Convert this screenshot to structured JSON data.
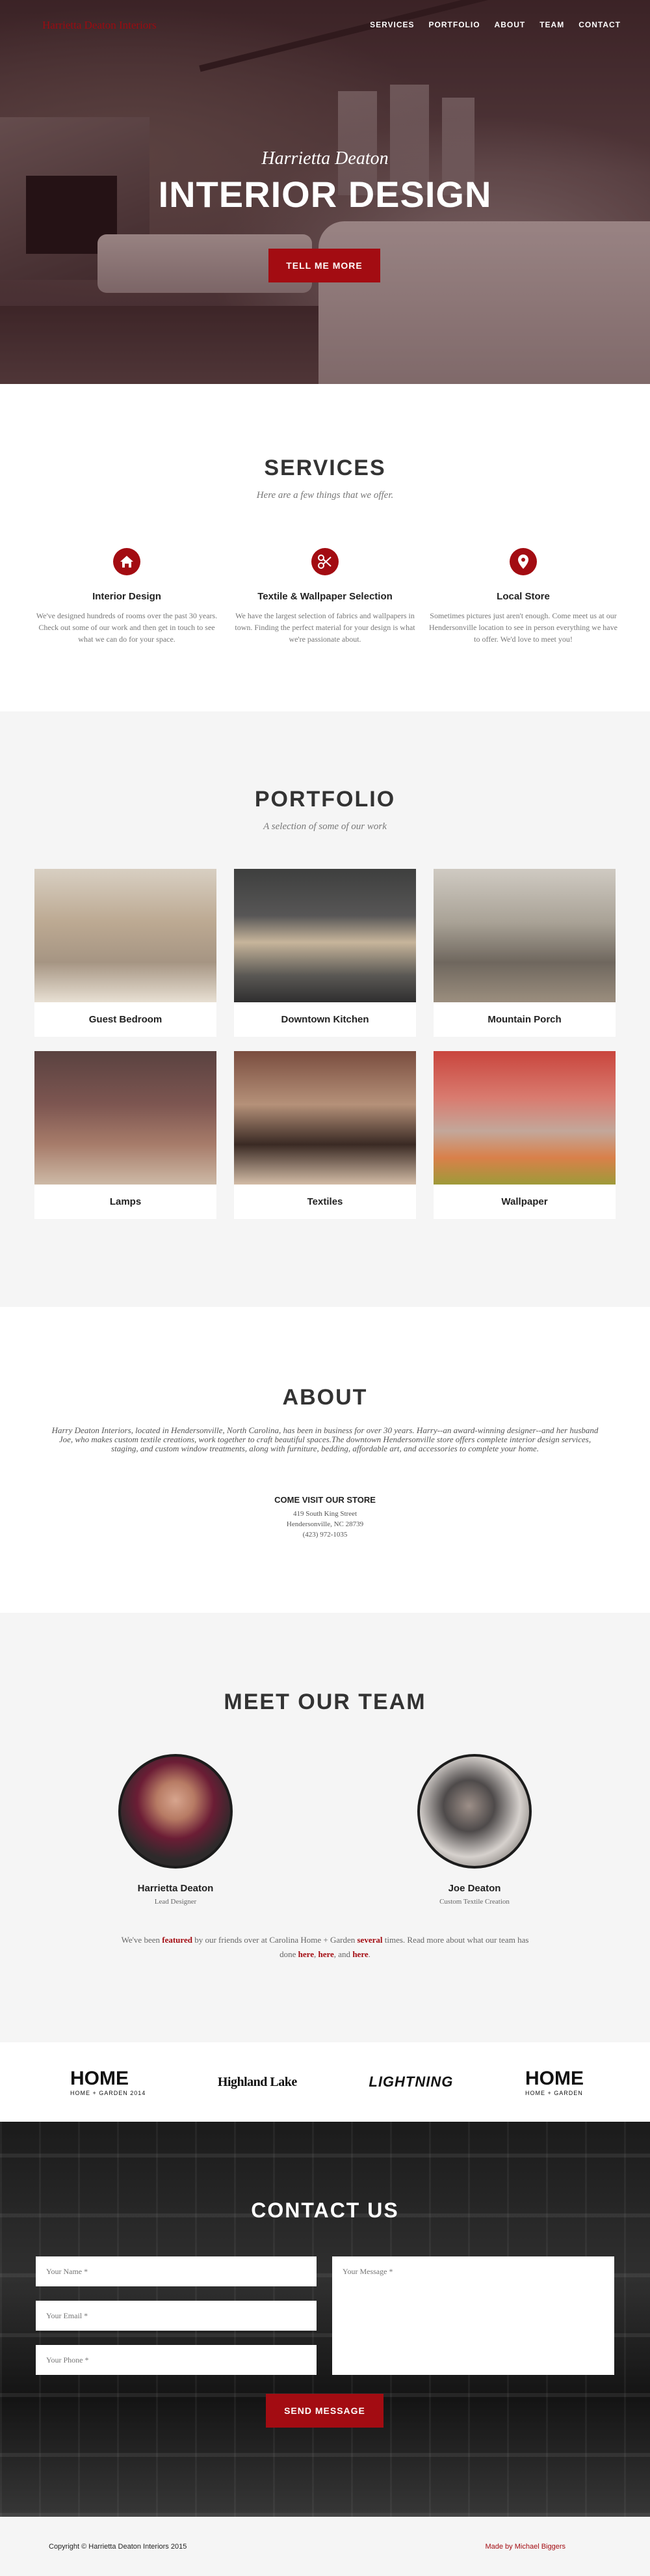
{
  "nav": {
    "brand": "Harrietta Deaton Interiors",
    "items": [
      "SERVICES",
      "PORTFOLIO",
      "ABOUT",
      "TEAM",
      "CONTACT"
    ]
  },
  "hero": {
    "subtitle": "Harrietta Deaton",
    "title": "INTERIOR DESIGN",
    "button": "TELL ME MORE"
  },
  "services": {
    "title": "SERVICES",
    "subtitle": "Here are a few things that we offer.",
    "items": [
      {
        "icon": "home-icon",
        "title": "Interior Design",
        "text": "We've designed hundreds of rooms over the past 30 years. Check out some of our work and then get in touch to see what we can do for your space."
      },
      {
        "icon": "scissors-icon",
        "title": "Textile & Wallpaper Selection",
        "text": "We have the largest selection of fabrics and wallpapers in town. Finding the perfect material for your design is what we're passionate about."
      },
      {
        "icon": "map-marker-icon",
        "title": "Local Store",
        "text": "Sometimes pictures just aren't enough. Come meet us at our Hendersonville location to see in person everything we have to offer. We'd love to meet you!"
      }
    ]
  },
  "portfolio": {
    "title": "PORTFOLIO",
    "subtitle": "A selection of some of our work",
    "items": [
      "Guest Bedroom",
      "Downtown Kitchen",
      "Mountain Porch",
      "Lamps",
      "Textiles",
      "Wallpaper"
    ]
  },
  "about": {
    "title": "ABOUT",
    "text": "Harry Deaton Interiors, located in Hendersonville, North Carolina, has been in business for over 30 years. Harry--an award-winning designer--and her husband Joe, who makes custom textile creations, work together to craft beautiful spaces.The downtown Hendersonville store offers complete interior design services, staging, and custom window treatments, along with furniture, bedding, affordable art, and accessories to complete your home.",
    "visit_title": "COME VISIT OUR STORE",
    "address_line1": "419 South King Street",
    "address_line2": "Hendersonville, NC 28739",
    "phone": "(423) 972-1035"
  },
  "team": {
    "title": "MEET OUR TEAM",
    "members": [
      {
        "name": "Harrietta Deaton",
        "role": "Lead Designer"
      },
      {
        "name": "Joe Deaton",
        "role": "Custom Textile Creation"
      }
    ],
    "note_1": "We've been ",
    "note_link_featured": "featured",
    "note_2": " by our friends over at Carolina Home + Garden ",
    "note_link_several": "several",
    "note_3": " times. Read more about what our team has done ",
    "note_link_here1": "here",
    "note_4": ", ",
    "note_link_here2": "here",
    "note_5": ", and ",
    "note_link_here3": "here",
    "note_6": "."
  },
  "logos": {
    "logo1": "HOME",
    "logo1_small": "HOME + GARDEN 2014",
    "logo2": "Highland Lake",
    "logo3": "LIGHTNING",
    "logo4": "HOME",
    "logo4_small": "HOME + GARDEN"
  },
  "contact": {
    "title": "CONTACT US",
    "name_placeholder": "Your Name *",
    "email_placeholder": "Your Email *",
    "phone_placeholder": "Your Phone *",
    "message_placeholder": "Your Message *",
    "button": "SEND MESSAGE"
  },
  "footer": {
    "copyright": "Copyright © Harrietta Deaton Interiors 2015",
    "made_by": "Made by Michael Biggers"
  },
  "colors": {
    "accent": "#a30c12",
    "light_bg": "#f5f5f5"
  }
}
